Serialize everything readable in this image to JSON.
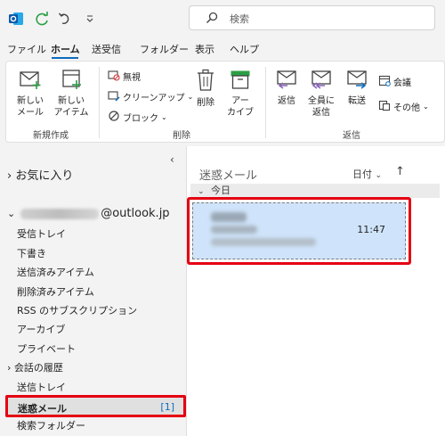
{
  "search": {
    "placeholder": "検索"
  },
  "menu": {
    "tabs": [
      "ファイル",
      "ホーム",
      "送受信",
      "フォルダー",
      "表示",
      "ヘルプ"
    ]
  },
  "ribbon": {
    "new_mail": "新しい\nメール",
    "new_item": "新しい\nアイテム",
    "ignore": "無視",
    "cleanup": "クリーンアップ",
    "block": "ブロック",
    "delete": "削除",
    "archive": "アー\nカイブ",
    "reply": "返信",
    "reply_all": "全員に\n返信",
    "forward": "転送",
    "meeting": "会議",
    "other": "その他",
    "group_new": "新規作成",
    "group_delete": "削除",
    "group_respond": "返信"
  },
  "folders": {
    "favorites": "お気に入り",
    "account_domain": "@outlook.jp",
    "items": [
      "受信トレイ",
      "下書き",
      "送信済みアイテム",
      "削除済みアイテム",
      "RSS のサブスクリプション",
      "アーカイブ",
      "プライベート",
      "会話の履歴",
      "送信トレイ"
    ],
    "junk": "迷惑メール",
    "junk_count": "[1]",
    "search_folders": "検索フォルダー"
  },
  "message_list": {
    "title": "迷惑メール",
    "sort": "日付",
    "group": "今日",
    "message_time": "11:47"
  },
  "colors": {
    "accent": "#0f6cbd",
    "highlight": "#e50012",
    "selected": "#cfe4fa"
  }
}
